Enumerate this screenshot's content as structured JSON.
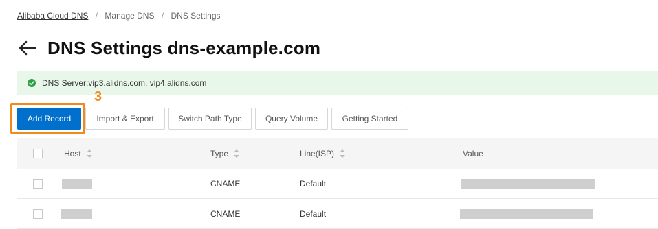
{
  "breadcrumb": {
    "home": "Alibaba Cloud DNS",
    "separator": "/",
    "manage": "Manage DNS",
    "current": "DNS Settings"
  },
  "header": {
    "title": "DNS Settings dns-example.com"
  },
  "alert": {
    "text": "DNS Server:vip3.alidns.com, vip4.alidns.com",
    "status_color": "#2ba245"
  },
  "step_marker": "3",
  "toolbar": {
    "add_record": "Add Record",
    "import_export": "Import & Export",
    "switch_path_type": "Switch Path Type",
    "query_volume": "Query Volume",
    "getting_started": "Getting Started"
  },
  "table": {
    "columns": {
      "host": "Host",
      "type": "Type",
      "line": "Line(ISP)",
      "value": "Value"
    },
    "rows": [
      {
        "host": "",
        "type": "CNAME",
        "line": "Default",
        "value": ""
      },
      {
        "host": "",
        "type": "CNAME",
        "line": "Default",
        "value": ""
      }
    ]
  },
  "colors": {
    "primary": "#0070cc",
    "highlight": "#f08a1c",
    "alert_bg": "#e9f7ea"
  }
}
